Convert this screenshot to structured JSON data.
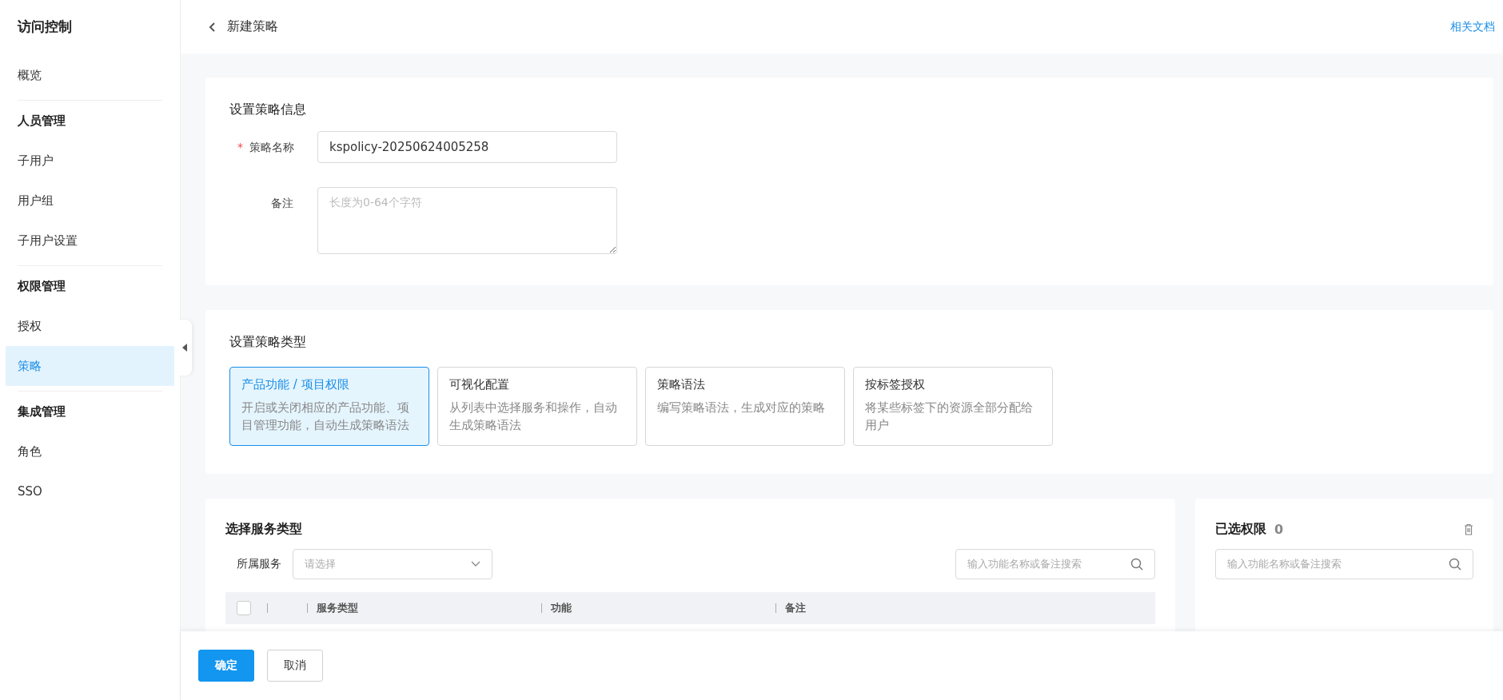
{
  "sidebar": {
    "title": "访问控制",
    "items": [
      {
        "kind": "item",
        "label": "概览",
        "selected": false
      },
      {
        "kind": "group",
        "label": "人员管理"
      },
      {
        "kind": "item",
        "label": "子用户",
        "selected": false
      },
      {
        "kind": "item",
        "label": "用户组",
        "selected": false
      },
      {
        "kind": "item",
        "label": "子用户设置",
        "selected": false
      },
      {
        "kind": "group",
        "label": "权限管理"
      },
      {
        "kind": "item",
        "label": "授权",
        "selected": false
      },
      {
        "kind": "item",
        "label": "策略",
        "selected": true
      },
      {
        "kind": "group",
        "label": "集成管理"
      },
      {
        "kind": "item",
        "label": "角色",
        "selected": false
      },
      {
        "kind": "item",
        "label": "SSO",
        "selected": false
      }
    ]
  },
  "header": {
    "title": "新建策略",
    "link": "相关文档"
  },
  "policy_info": {
    "title": "设置策略信息",
    "name_label": "策略名称",
    "required_mark": "*",
    "name_value": "kspolicy-20250624005258",
    "note_label": "备注",
    "note_placeholder": "长度为0-64个字符"
  },
  "policy_type": {
    "title": "设置策略类型",
    "options": [
      {
        "title": "产品功能 / 项目权限",
        "description": "开启或关闭相应的产品功能、项目管理功能，自动生成策略语法",
        "selected": true
      },
      {
        "title": "可视化配置",
        "description": "从列表中选择服务和操作，自动生成策略语法",
        "selected": false
      },
      {
        "title": "策略语法",
        "description": "编写策略语法，生成对应的策略",
        "selected": false
      },
      {
        "title": "按标签授权",
        "description": "将某些标签下的资源全部分配给用户",
        "selected": false
      }
    ]
  },
  "service_select": {
    "title": "选择服务类型",
    "service_label": "所属服务",
    "service_placeholder": "请选择",
    "search_placeholder": "输入功能名称或备注搜索",
    "select_all_checked": false,
    "columns": [
      "服务类型",
      "功能",
      "备注"
    ]
  },
  "selected_permissions": {
    "title": "已选权限",
    "count": "0",
    "search_placeholder": "输入功能名称或备注搜索"
  },
  "footer": {
    "buttons": [
      {
        "label": "确定",
        "kind": "primary"
      },
      {
        "label": "取消",
        "kind": "default"
      }
    ]
  }
}
